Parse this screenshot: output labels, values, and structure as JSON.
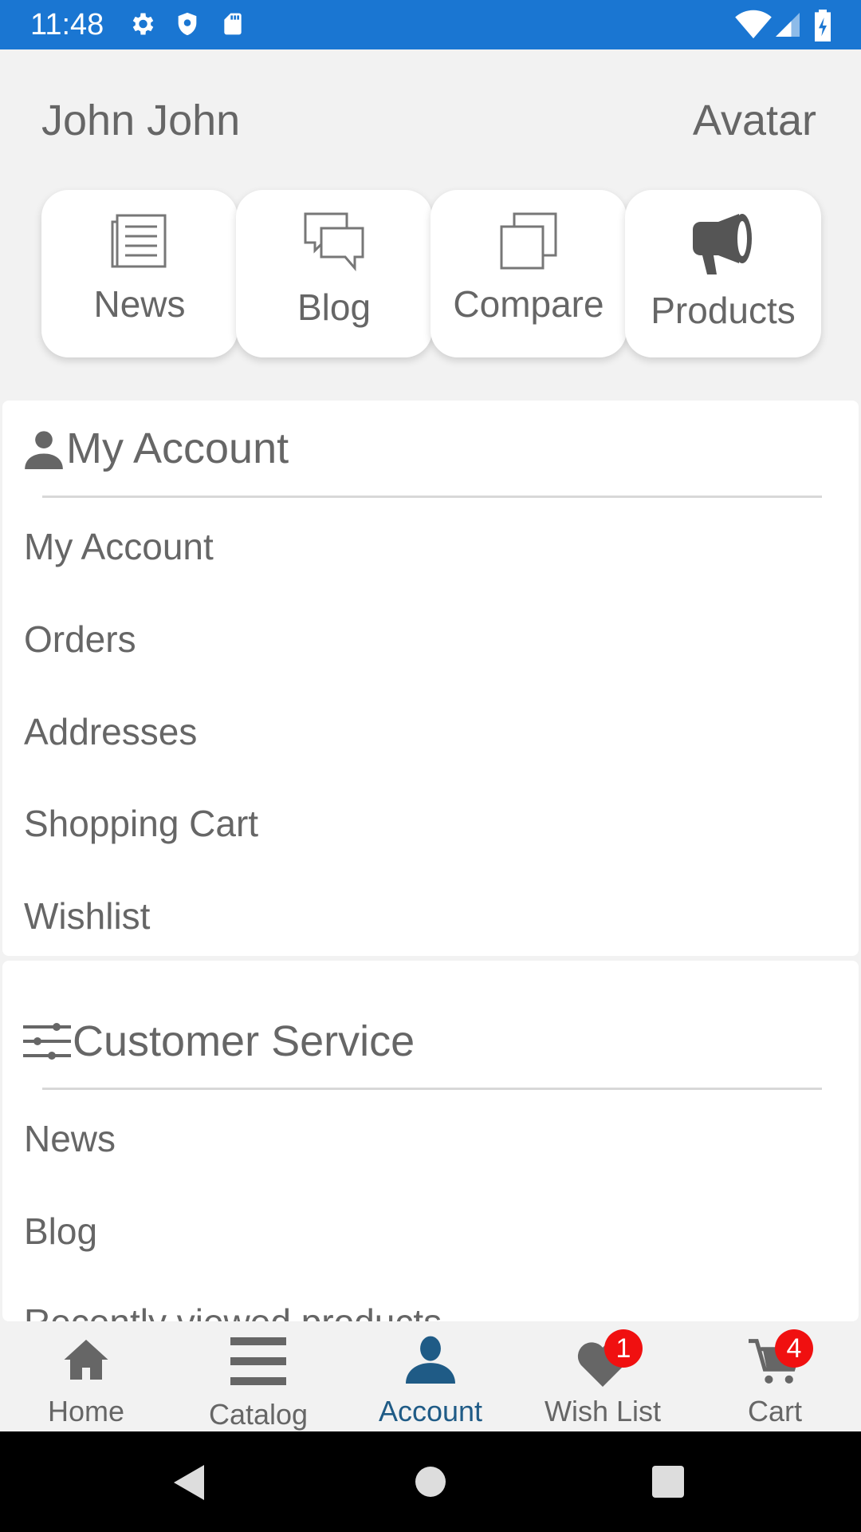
{
  "status_bar": {
    "time": "11:48"
  },
  "header": {
    "user_name": "John John",
    "avatar_label": "Avatar"
  },
  "quick_tiles": [
    {
      "label": "News",
      "icon": "newspaper-icon"
    },
    {
      "label": "Blog",
      "icon": "chat-bubbles-icon"
    },
    {
      "label": "Compare",
      "icon": "compare-squares-icon"
    },
    {
      "label": "Products",
      "icon": "megaphone-icon"
    }
  ],
  "my_account": {
    "title": "My Account",
    "icon": "person-icon",
    "items": [
      "My Account",
      "Orders",
      "Addresses",
      "Shopping Cart",
      "Wishlist"
    ]
  },
  "customer_service": {
    "title": "Customer Service",
    "icon": "sliders-icon",
    "items": [
      "News",
      "Blog",
      "Recently viewed products"
    ]
  },
  "bottom_nav": [
    {
      "label": "Home",
      "icon": "home-icon"
    },
    {
      "label": "Catalog",
      "icon": "menu-icon"
    },
    {
      "label": "Account",
      "icon": "person-icon",
      "active": true
    },
    {
      "label": "Wish List",
      "icon": "heart-icon",
      "badge": "1"
    },
    {
      "label": "Cart",
      "icon": "cart-icon",
      "badge": "4"
    }
  ],
  "colors": {
    "status_bar": "#1a76d2",
    "active_nav": "#1f5b86",
    "badge": "#f01010",
    "text": "#666666"
  }
}
